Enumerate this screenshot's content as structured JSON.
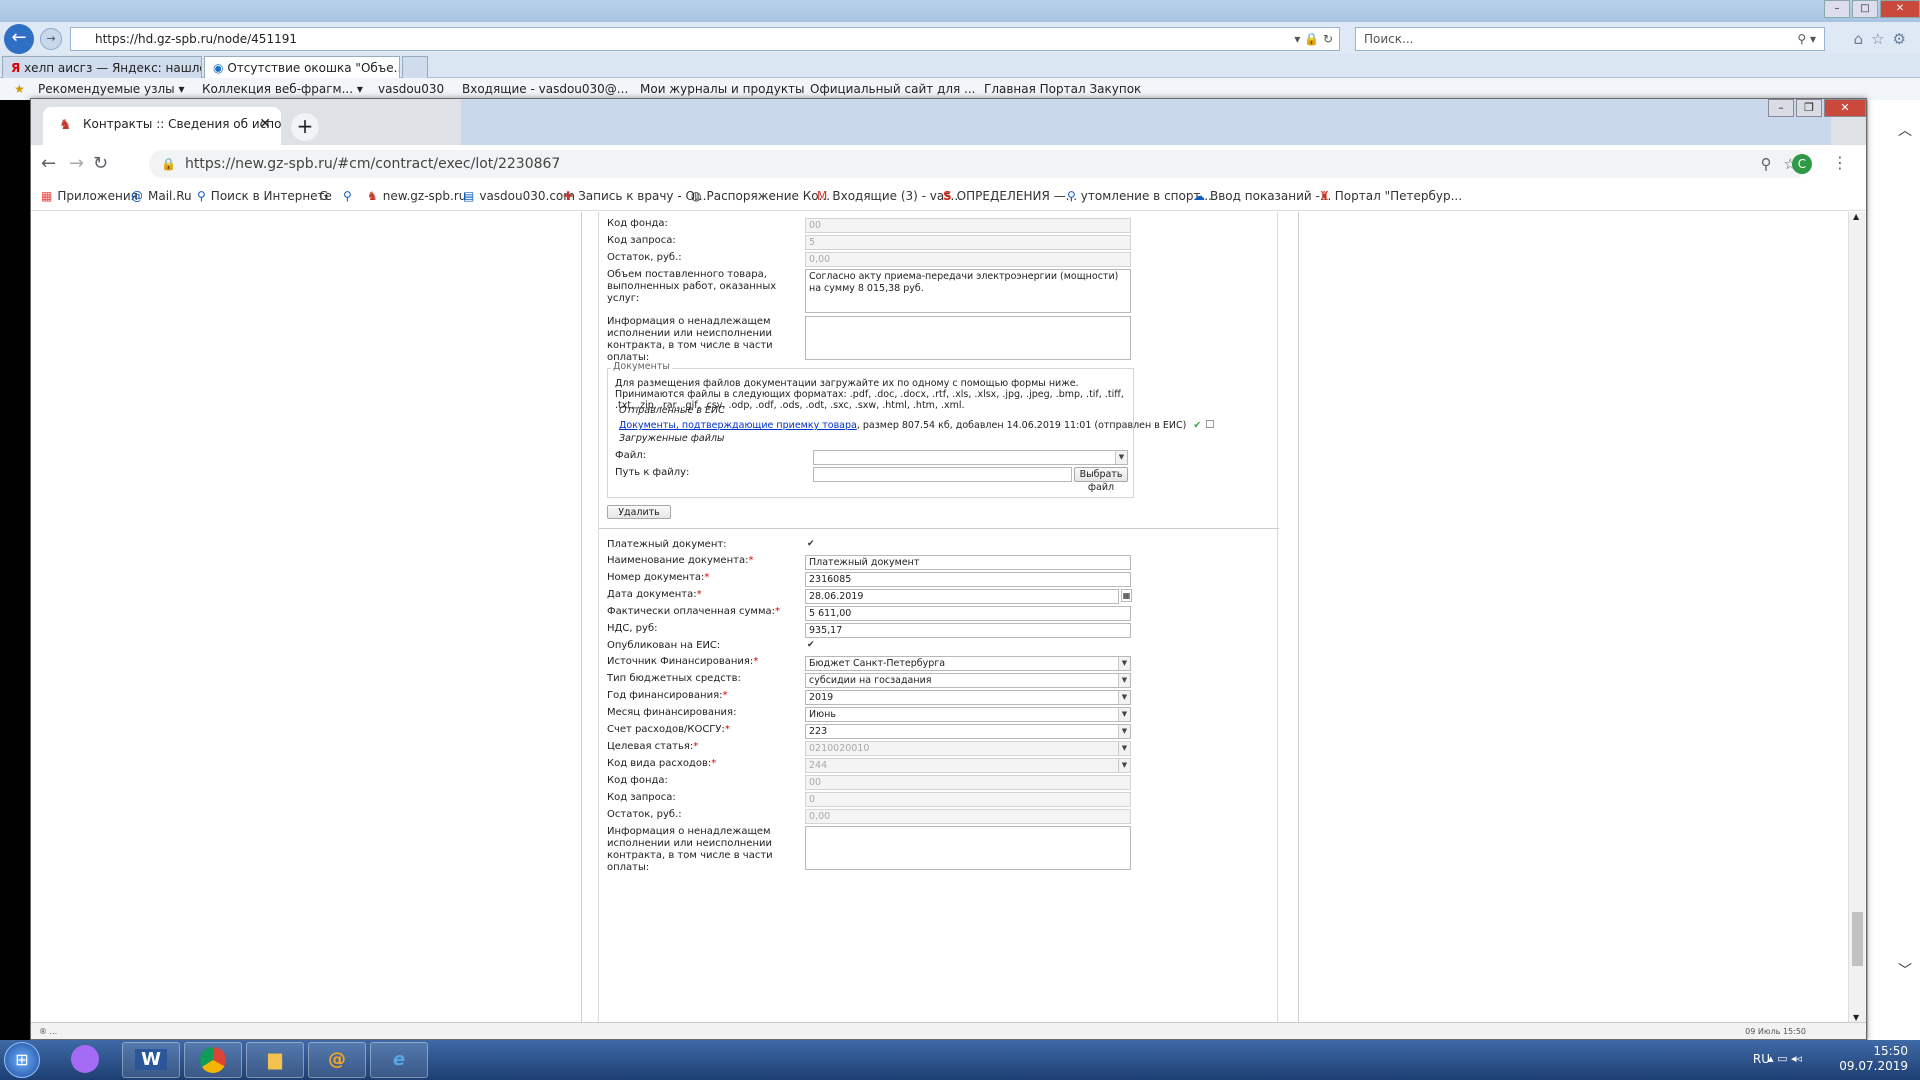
{
  "ie": {
    "address": "https://hd.gz-spb.ru/node/451191",
    "search_placeholder": "Поиск...",
    "tabs": [
      "хелп аисгз — Яндекс: нашлос...",
      "Отсутствие окошка \"Объе..."
    ],
    "favorites": [
      "Рекомендуемые узлы ▾",
      "Коллекция веб-фрагм... ▾",
      "vasdou030",
      "Входящие - vasdou030@...",
      "Мои журналы и продукты",
      "Официальный сайт для ...",
      "Главная Портал Закупок"
    ]
  },
  "chrome": {
    "tab_title": "Контракты :: Сведения об испол",
    "url": "https://new.gz-spb.ru/#cm/contract/exec/lot/2230867",
    "avatar_letter": "С",
    "bookmarks": [
      "Приложения",
      "Mail.Ru",
      "Поиск в Интернете",
      "G",
      "",
      "new.gz-spb.ru",
      "vasdou030.com",
      "Запись к врачу - О...",
      "Распоряжение Ко...",
      "Входящие (3) - vas...",
      "ОПРЕДЕЛЕНИЯ —...",
      "утомление в спорт...",
      "Ввод показаний -...",
      "Портал \"Петербур..."
    ]
  },
  "form_top": {
    "fund_code_label": "Код фонда:",
    "fund_code": "00",
    "request_code_label": "Код запроса:",
    "request_code": "5",
    "balance_label": "Остаток, руб.:",
    "balance": "0,00",
    "volume_label": "Объем поставленного товара, выполненных работ, оказанных услуг:",
    "volume": "Согласно акту приема-передачи электроэнергии (мощности) на сумму 8 015,38 руб.",
    "info_label": "Информация о ненадлежащем исполнении или неисполнении контракта, в том числе в части оплаты:",
    "info": ""
  },
  "documents": {
    "legend": "Документы",
    "instructions": "Для размещения файлов документации загружайте их по одному с помощью формы ниже. Принимаются файлы в следующих форматах: .pdf, .doc, .docx, .rtf, .xls, .xlsx, .jpg, .jpeg, .bmp, .tif, .tiff, .txt, .zip, .rar, .gif, .csv, .odp, .odf, .ods, .odt, .sxc, .sxw, .html, .htm, .xml.",
    "sent_label": "Отправленные в ЕИС",
    "file_link": "Документы, подтверждающие приемку товара",
    "file_meta": ", размер 807.54 кб, добавлен 14.06.2019 11:01 (отправлен в ЕИС)",
    "uploaded_label": "Загруженные файлы",
    "file_label": "Файл:",
    "path_label": "Путь к файлу:",
    "browse_button": "Выбрать файл",
    "delete_button": "Удалить"
  },
  "payment": {
    "payment_doc_label": "Платежный документ:",
    "doc_name_label": "Наименование документа:",
    "doc_name": "Платежный документ",
    "doc_number_label": "Номер документа:",
    "doc_number": "2316085",
    "doc_date_label": "Дата документа:",
    "doc_date": "28.06.2019",
    "paid_sum_label": "Фактически оплаченная сумма:",
    "paid_sum": "5 611,00",
    "vat_label": "НДС, руб:",
    "vat": "935,17",
    "published_label": "Опубликован на ЕИС:",
    "source_label": "Источник Финансирования:",
    "source": "Бюджет Санкт-Петербурга",
    "budget_type_label": "Тип бюджетных средств:",
    "budget_type": "субсидии на госзадания",
    "year_label": "Год финансирования:",
    "year": "2019",
    "month_label": "Месяц финансирования:",
    "month": "Июнь",
    "account_label": "Счет расходов/КОСГУ:",
    "account": "223",
    "target_label": "Целевая статья:",
    "target": "0210020010",
    "expense_code_label": "Код вида расходов:",
    "expense_code": "244",
    "fund_code_label": "Код фонда:",
    "fund_code": "00",
    "request_code_label": "Код запроса:",
    "request_code": "0",
    "balance_label": "Остаток, руб.:",
    "balance": "0,00",
    "info_label": "Информация о ненадлежащем исполнении или неисполнении контракта, в том числе в части оплаты:"
  },
  "status": {
    "left": "® ...",
    "right": "09 Июль 15:50"
  },
  "taskbar": {
    "lang": "RU",
    "time": "15:50",
    "date": "09.07.2019"
  }
}
